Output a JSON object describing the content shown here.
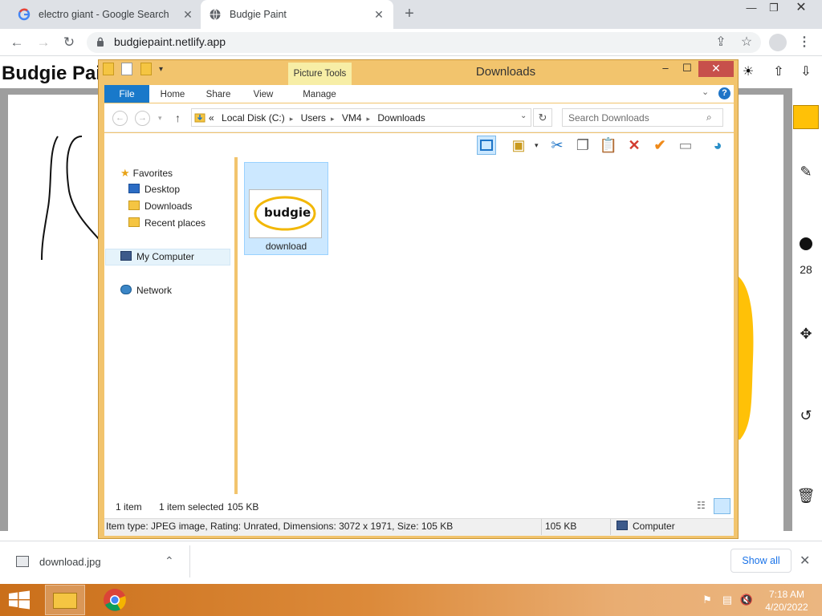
{
  "browser": {
    "tabs": [
      {
        "title": "electro giant - Google Search",
        "active": false
      },
      {
        "title": "Budgie Paint",
        "active": true
      }
    ],
    "url": "budgiepaint.netlify.app"
  },
  "app": {
    "title": "Budgie Paint",
    "brush_size": "28",
    "color": "#ffc107"
  },
  "explorer": {
    "title": "Downloads",
    "context_tab": "Picture Tools",
    "ribbon_tabs": [
      "File",
      "Home",
      "Share",
      "View",
      "Manage"
    ],
    "address": {
      "prefix": "«",
      "parts": [
        "Local Disk (C:)",
        "Users",
        "VM4",
        "Downloads"
      ]
    },
    "search_placeholder": "Search Downloads",
    "nav": {
      "favorites": "Favorites",
      "favorites_items": [
        "Desktop",
        "Downloads",
        "Recent places"
      ],
      "computer": "My Computer",
      "network": "Network"
    },
    "file": {
      "name": "download",
      "thumb_text": "budgie"
    },
    "status": {
      "count": "1 item",
      "selected": "1 item selected",
      "size": "105 KB"
    },
    "details": {
      "info": "Item type: JPEG image, Rating: Unrated, Dimensions: 3072 x 1971, Size: 105 KB",
      "size": "105 KB",
      "location": "Computer"
    }
  },
  "downloads_shelf": {
    "file": "download.jpg",
    "show_all": "Show all"
  },
  "taskbar": {
    "time": "7:18 AM",
    "date": "4/20/2022"
  }
}
